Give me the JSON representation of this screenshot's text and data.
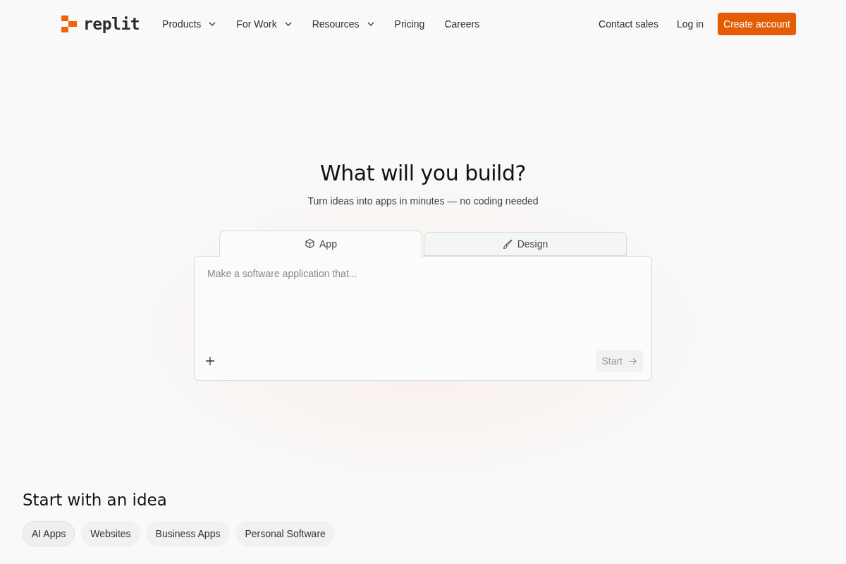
{
  "logo": {
    "text": "replit"
  },
  "nav": [
    {
      "label": "Products",
      "dropdown": true
    },
    {
      "label": "For Work",
      "dropdown": true
    },
    {
      "label": "Resources",
      "dropdown": true
    },
    {
      "label": "Pricing",
      "dropdown": false
    },
    {
      "label": "Careers",
      "dropdown": false
    }
  ],
  "header_actions": {
    "contact": "Contact sales",
    "login": "Log in",
    "signup": "Create account"
  },
  "hero": {
    "title": "What will you build?",
    "subtitle": "Turn ideas into apps in minutes — no coding needed"
  },
  "mode_tabs": [
    {
      "label": "App",
      "kind": "cube",
      "selected": true
    },
    {
      "label": "Design",
      "kind": "brush",
      "selected": false
    }
  ],
  "prompt": {
    "placeholder": "Make a software application that...",
    "start": "Start",
    "start_disabled": true
  },
  "ideas": {
    "title": "Start with an idea",
    "chips": [
      {
        "label": "AI Apps",
        "selected": true
      },
      {
        "label": "Websites",
        "selected": false
      },
      {
        "label": "Business Apps",
        "selected": false
      },
      {
        "label": "Personal Software",
        "selected": false
      }
    ]
  }
}
